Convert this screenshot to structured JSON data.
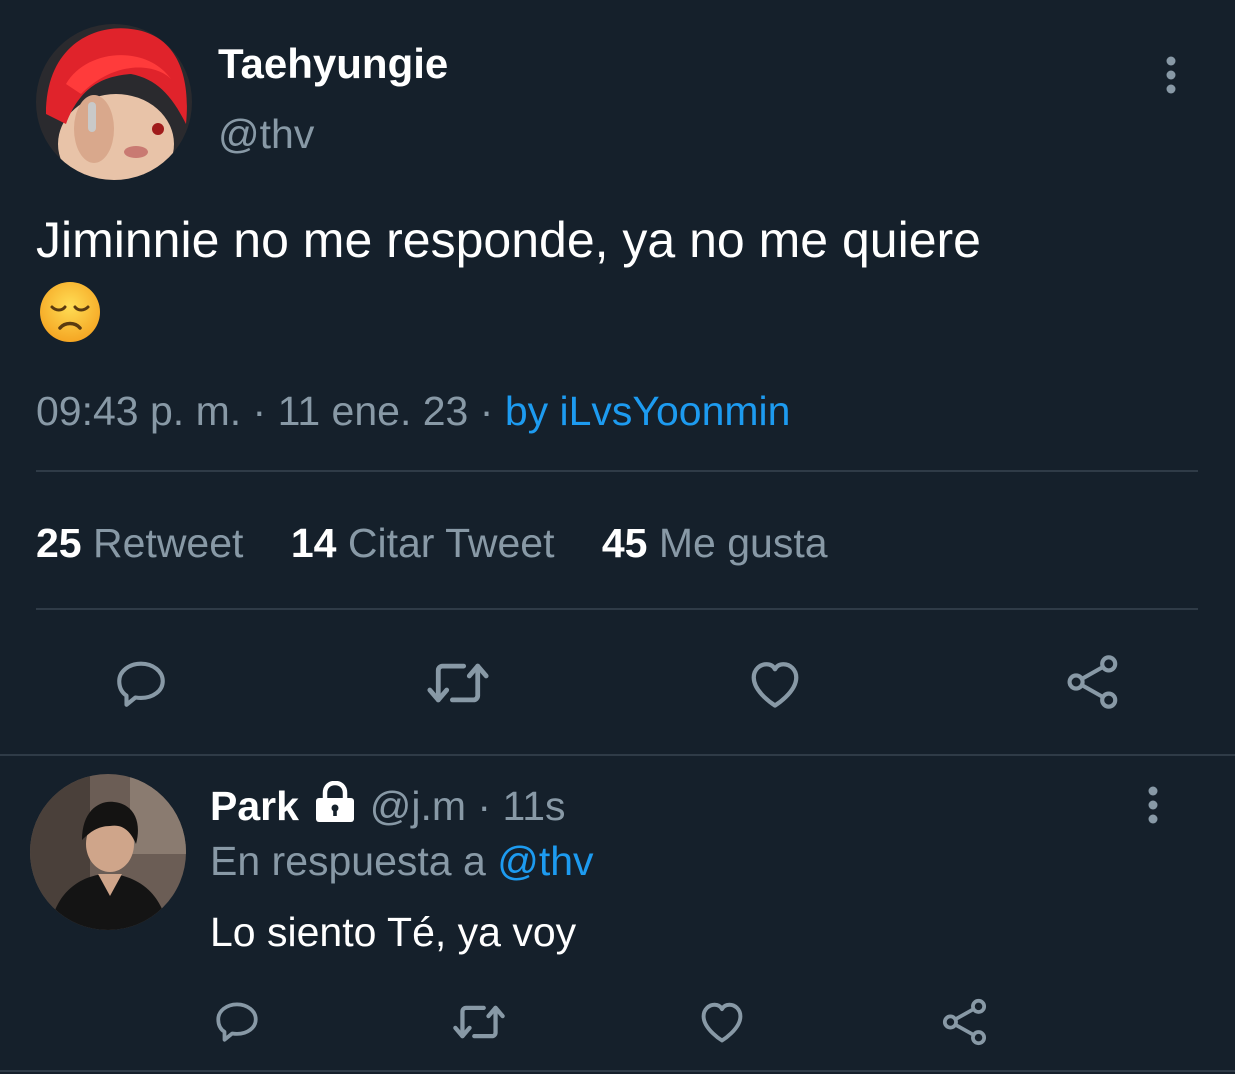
{
  "main_tweet": {
    "display_name": "Taehyungie",
    "handle": "@thv",
    "text": "Jiminnie no me responde, ya no me quiere",
    "emoji": "😞",
    "time": "09:43 p. m.",
    "sep1": "·",
    "date": "11 ene. 23",
    "sep2": "·",
    "via": "by iLvsYoonmin",
    "stats": {
      "retweets": "25",
      "retweets_label": "Retweet",
      "quotes": "14",
      "quotes_label": "Citar Tweet",
      "likes": "45",
      "likes_label": "Me gusta"
    }
  },
  "reply": {
    "display_name": "Park",
    "handle": "@j.m",
    "sep": "·",
    "time_ago": "11s",
    "replying_to_label": "En respuesta a",
    "replying_to_handle": "@thv",
    "text": "Lo siento Té, ya voy"
  },
  "icons": [
    "more-vert-icon",
    "reply-icon",
    "retweet-icon",
    "heart-icon",
    "share-icon",
    "lock-icon"
  ],
  "colors": {
    "background": "#15202b",
    "muted_text": "#8899a6",
    "link": "#1d9bf0",
    "divider": "#2f3b47"
  }
}
